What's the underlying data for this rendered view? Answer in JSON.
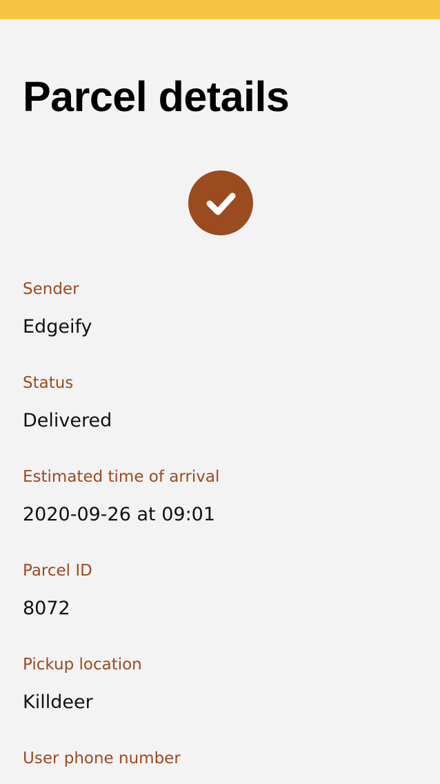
{
  "header": {
    "title": "Parcel details"
  },
  "status_icon": "check-icon",
  "colors": {
    "top_bar": "#f6c544",
    "accent": "#9c4a1f",
    "background": "#f3f3f3"
  },
  "fields": [
    {
      "label": "Sender",
      "value": "Edgeify"
    },
    {
      "label": "Status",
      "value": "Delivered"
    },
    {
      "label": "Estimated time of arrival",
      "value": "2020-09-26 at 09:01"
    },
    {
      "label": "Parcel ID",
      "value": "8072"
    },
    {
      "label": "Pickup location",
      "value": "Killdeer"
    },
    {
      "label": "User phone number",
      "value": ""
    }
  ]
}
